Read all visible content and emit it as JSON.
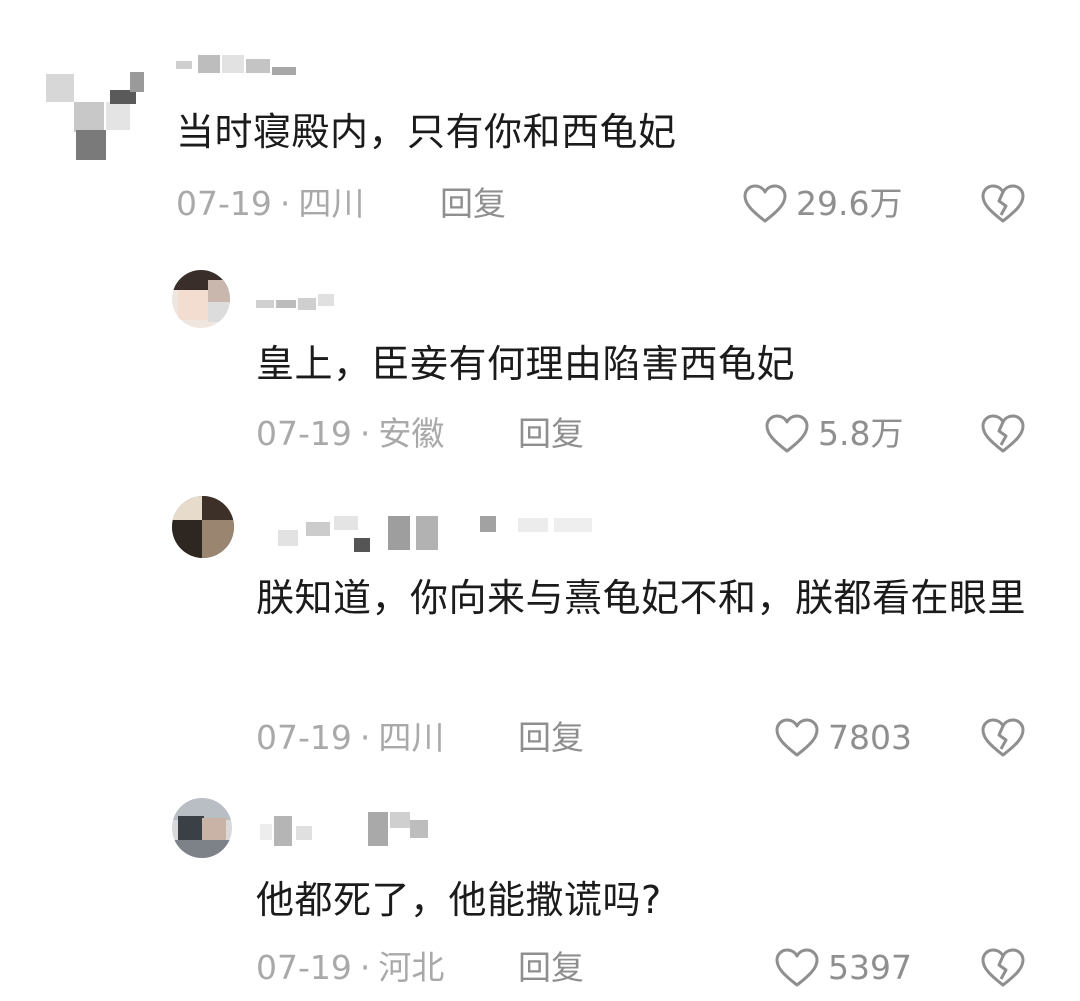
{
  "comments": [
    {
      "text": "当时寝殿内，只有你和西龟妃",
      "date": "07-19",
      "dot": "·",
      "region": "四川",
      "reply_label": "回复",
      "likes": "29.6万"
    },
    {
      "text": "皇上，臣妾有何理由陷害西龟妃",
      "date": "07-19",
      "dot": "·",
      "region": "安徽",
      "reply_label": "回复",
      "likes": "5.8万"
    },
    {
      "text": "朕知道，你向来与熹龟妃不和，朕都看在眼里",
      "date": "07-19",
      "dot": "·",
      "region": "四川",
      "reply_label": "回复",
      "likes": "7803"
    },
    {
      "text": "他都死了，他能撒谎吗?",
      "date": "07-19",
      "dot": "·",
      "region": "河北",
      "reply_label": "回复",
      "likes": "5397"
    }
  ],
  "colors": {
    "text": "#1b1b1b",
    "meta": "#a9a9a9",
    "icon": "#8f8f8f"
  },
  "icons": {
    "like": "heart-outline-icon",
    "dislike": "broken-heart-icon"
  }
}
